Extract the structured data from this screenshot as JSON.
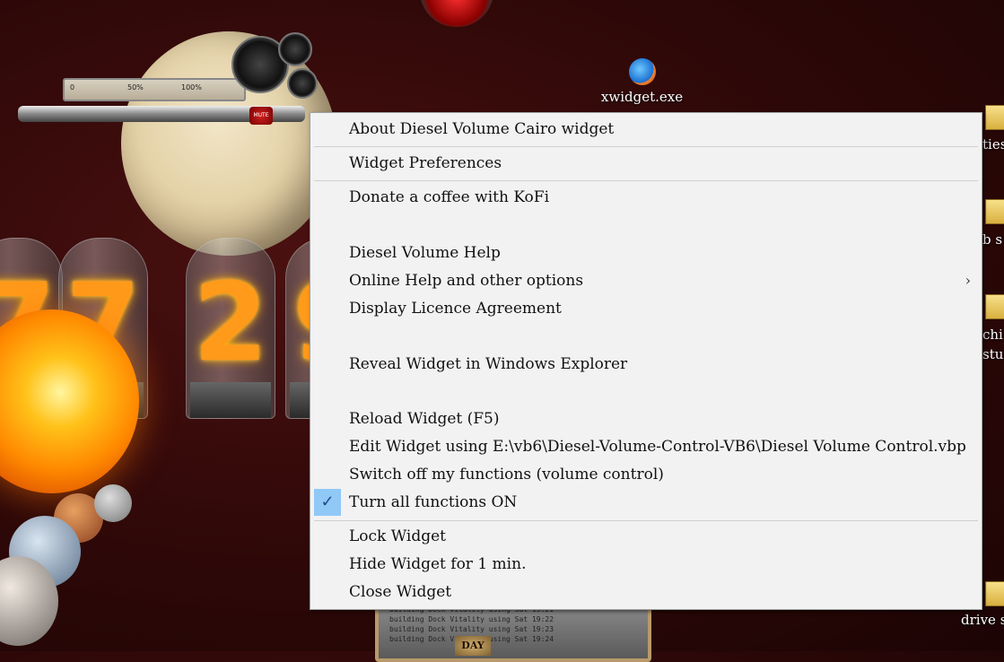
{
  "desktop": {
    "shortcut": {
      "label": "xwidget.exe",
      "icon": "xwidget-app-icon"
    },
    "right_labels": [
      "ties",
      "b s",
      "chi",
      "stuf",
      "drive s"
    ],
    "volume_gauge": {
      "ticks": [
        "0",
        "50%",
        "100%"
      ],
      "mute_label": "MUTE"
    },
    "clock_digits": [
      "7",
      "2",
      "9"
    ],
    "terminal": {
      "lines": [
        "building Dock Vitality using Sat 19:21",
        "building Dock Vitality using Sat 19:22",
        "building Dock Vitality using Sat 19:23",
        "building Dock Vitality using Sat 19:24"
      ],
      "badge": "DAY"
    }
  },
  "menu": {
    "items": {
      "about": "About Diesel Volume Cairo widget",
      "preferences": "Widget Preferences",
      "donate": "Donate a coffee with KoFi",
      "help": "Diesel Volume Help",
      "online_help": "Online Help and other options",
      "licence": "Display Licence Agreement",
      "reveal": "Reveal Widget in Windows Explorer",
      "reload": "Reload Widget (F5)",
      "edit": "Edit Widget using E:\\vb6\\Diesel-Volume-Control-VB6\\Diesel Volume Control.vbp",
      "switch_off": "Switch off my functions (volume control)",
      "turn_on": "Turn all functions ON",
      "lock": "Lock Widget",
      "hide": "Hide Widget for 1 min.",
      "close": "Close Widget"
    },
    "submenu_arrow": "›",
    "checkmark": "✓",
    "checked_item": "turn_on",
    "highlight_color": "#90c8f6"
  }
}
